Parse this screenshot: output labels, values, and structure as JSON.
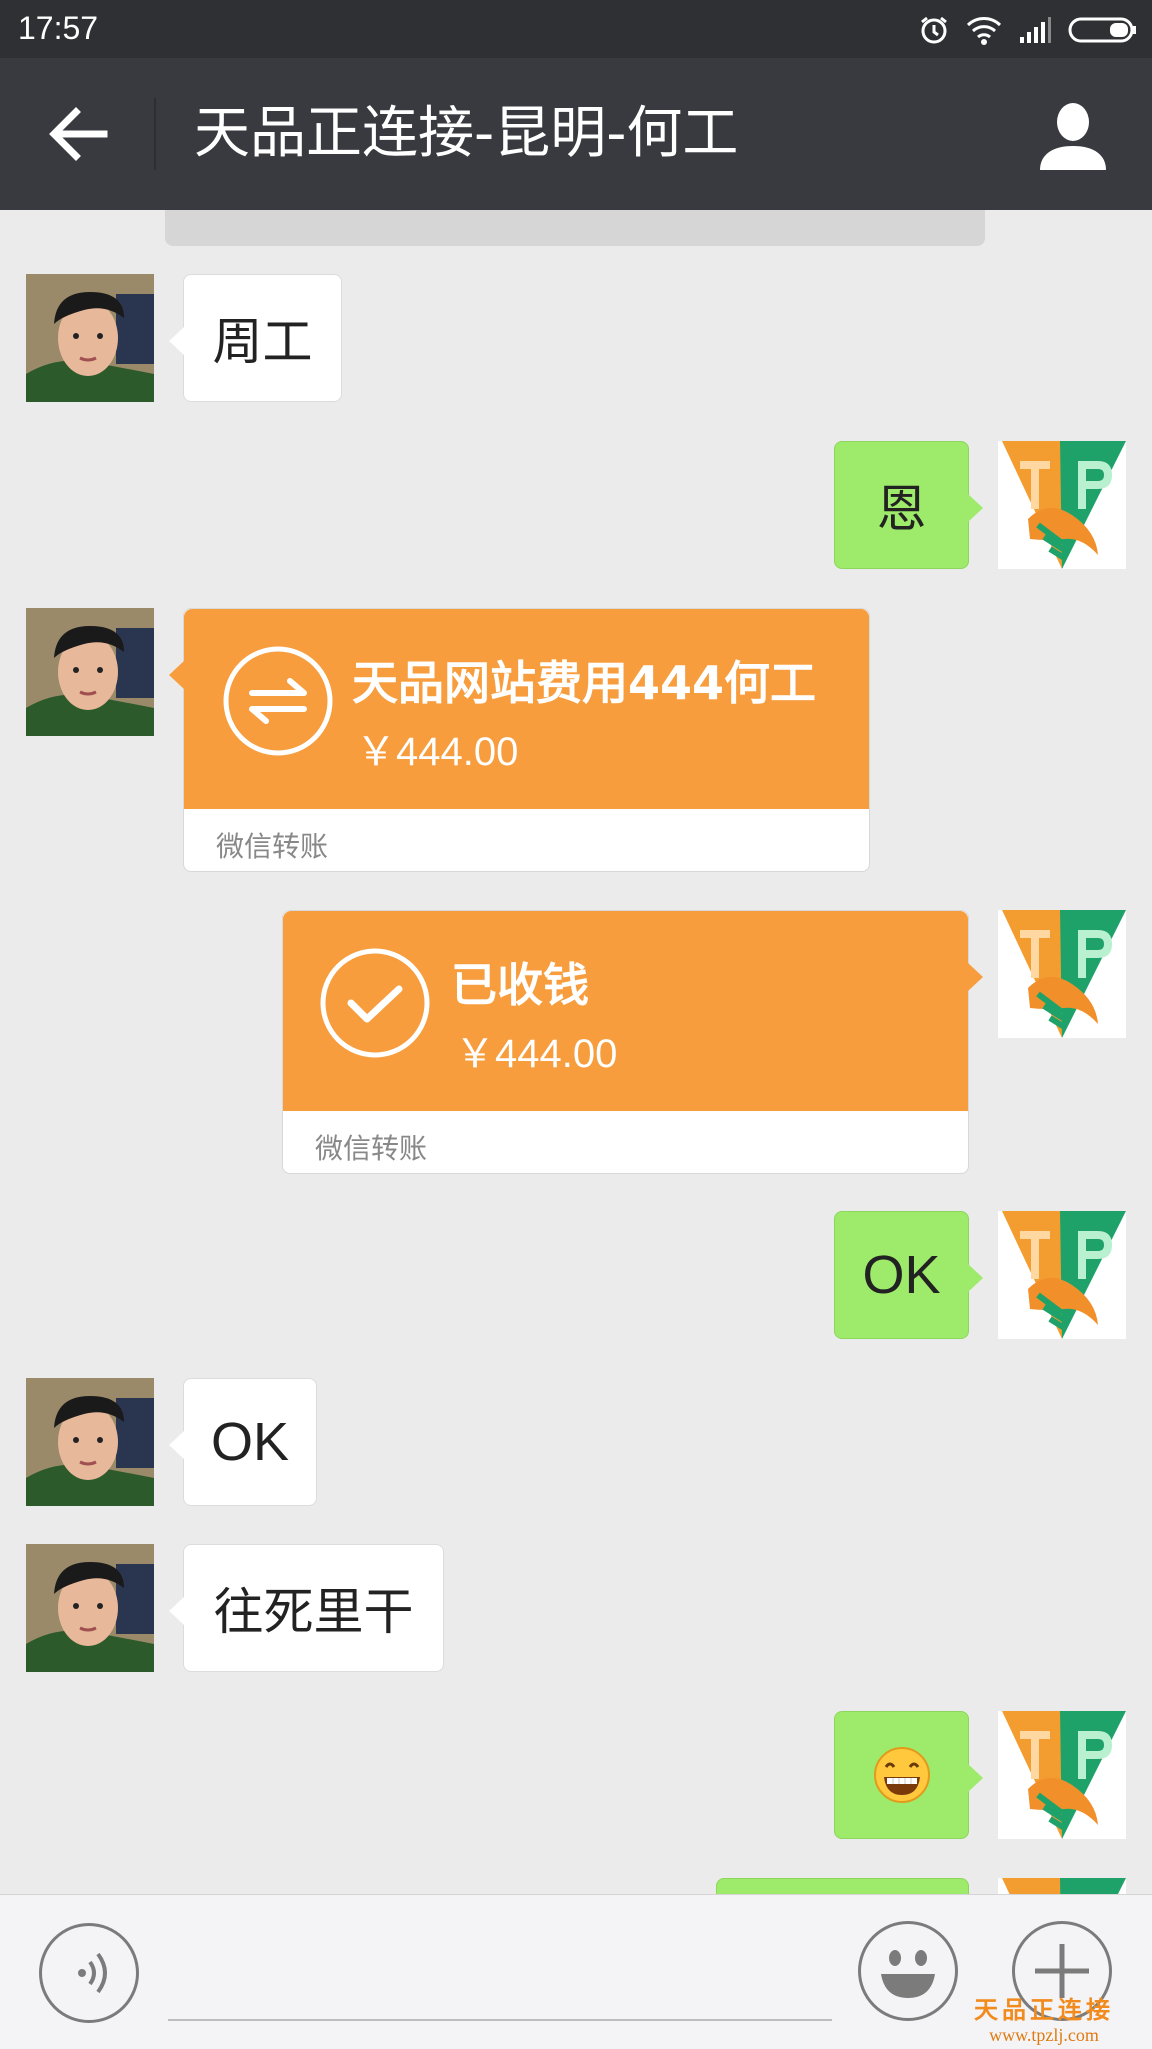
{
  "status_bar": {
    "time": "17:57",
    "icons": [
      "alarm-icon",
      "wifi-icon",
      "signal-icon",
      "battery-icon"
    ]
  },
  "header": {
    "title": "天品正连接-昆明-何工",
    "back_icon": "arrow-left-icon",
    "contact_icon": "person-icon"
  },
  "chat": {
    "messages": [
      {
        "side": "left",
        "type": "text",
        "text": "周工"
      },
      {
        "side": "right",
        "type": "text",
        "text": "恩"
      },
      {
        "side": "left",
        "type": "transfer",
        "title": "天品网站费用444何工",
        "amount": "￥444.00",
        "footer": "微信转账",
        "icon": "transfer-arrows-icon"
      },
      {
        "side": "right",
        "type": "transfer",
        "title": "已收钱",
        "amount": "￥444.00",
        "footer": "微信转账",
        "icon": "check-circle-icon"
      },
      {
        "side": "right",
        "type": "text",
        "text": "OK"
      },
      {
        "side": "left",
        "type": "text",
        "text": "OK"
      },
      {
        "side": "left",
        "type": "text",
        "text": "往死里干"
      },
      {
        "side": "right",
        "type": "emoji",
        "emoji": "grin-emoji"
      }
    ]
  },
  "input_bar": {
    "voice_icon": "voice-icon",
    "emoji_icon": "emoji-icon",
    "plus_icon": "plus-icon"
  },
  "watermark": {
    "name": "天品正连接",
    "url": "www.tpzlj.com"
  },
  "colors": {
    "status_bar": "#2e3033",
    "nav_bar": "#393a3f",
    "chat_bg": "#ebebeb",
    "bubble_out": "#9eea6a",
    "bubble_in": "#ffffff",
    "transfer": "#f79d3d"
  }
}
